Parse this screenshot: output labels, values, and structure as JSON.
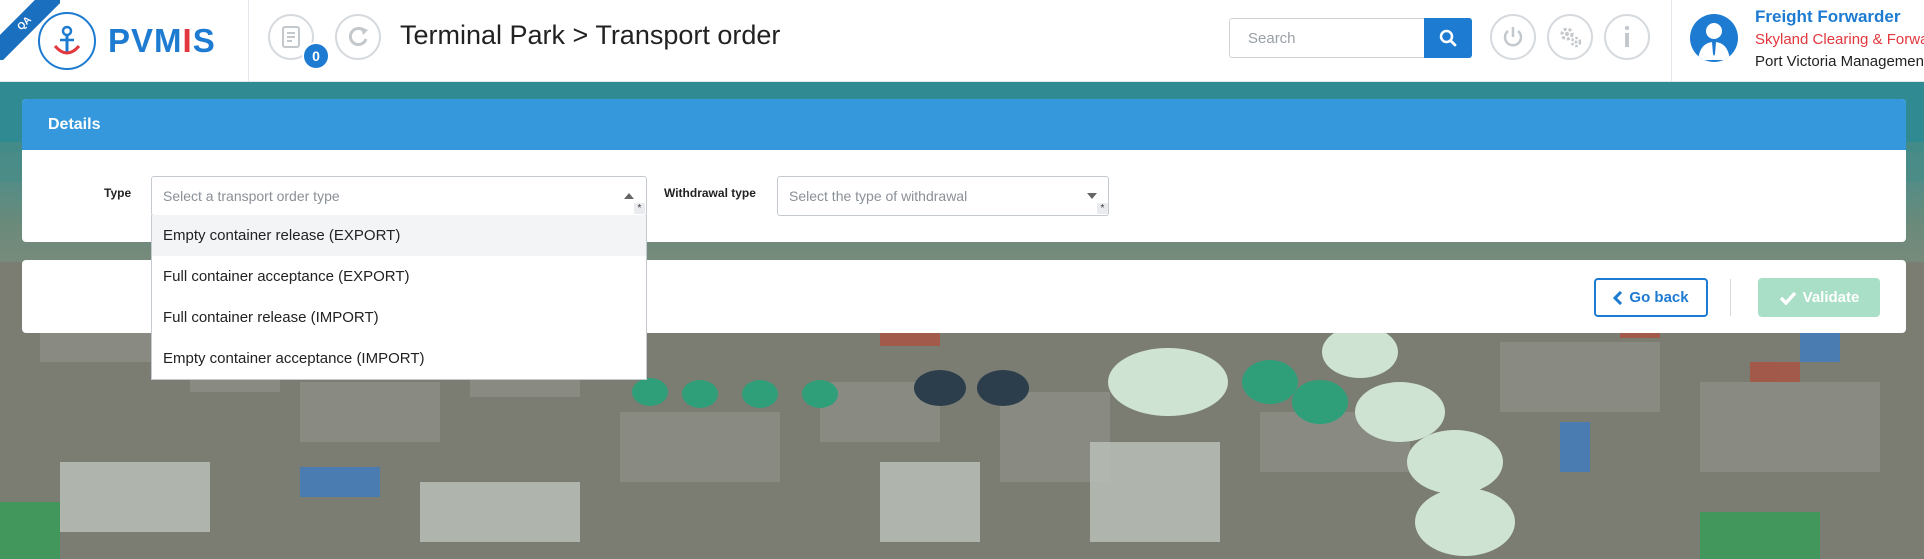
{
  "header": {
    "env_ribbon": "QA",
    "brand_name_prefix": "PVM",
    "brand_name_mid": "I",
    "brand_name_suffix": "S",
    "notification_count": "0",
    "page_title": "Terminal Park > Transport order",
    "search_placeholder": "Search",
    "user_role": "Freight Forwarder",
    "user_company": "Skyland Clearing & Forwarding",
    "user_org": "Port Victoria Management"
  },
  "details": {
    "title": "Details",
    "type_label": "Type",
    "type_placeholder": "Select a transport order type",
    "withdrawal_label": "Withdrawal type",
    "withdrawal_placeholder": "Select the type of withdrawal",
    "required_mark": "*",
    "type_options": [
      "Empty container release (EXPORT)",
      "Full container acceptance (EXPORT)",
      "Full container release (IMPORT)",
      "Empty container acceptance (IMPORT)"
    ]
  },
  "actions": {
    "go_back_label": "Go back",
    "validate_label": "Validate"
  },
  "icons": {
    "brand": "anchor-logo-icon",
    "notifications": "document-icon",
    "refresh": "refresh-icon",
    "search": "search-icon",
    "logout": "power-icon",
    "settings": "gears-icon",
    "info": "info-icon",
    "user": "user-avatar-icon",
    "back": "chevron-left-icon",
    "validate": "check-icon"
  },
  "colors": {
    "brand_blue": "#1d7bd1",
    "accent_red": "#e2373d",
    "card_header": "#3598dc",
    "validate_disabled": "#a9dfc6"
  }
}
